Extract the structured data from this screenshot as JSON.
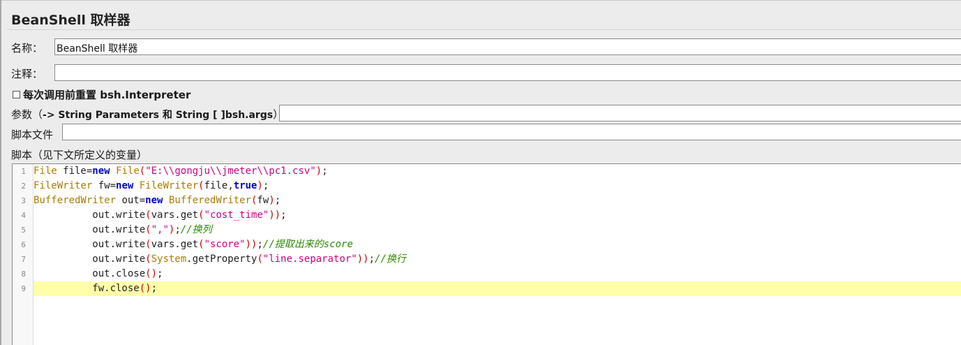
{
  "window": {
    "title": "BeanShell 取样器"
  },
  "form": {
    "name_label": "名称：",
    "name_value": "BeanShell 取样器",
    "comment_label": "注释：",
    "comment_value": "",
    "reset_checkbox_label": "每次调用前重置 bsh.Interpreter",
    "reset_checked": false,
    "params_label_prefix": "参数（",
    "params_label_bold": "-> String Parameters 和 String [ ]bsh.args",
    "params_label_suffix": "）",
    "params_value": "",
    "script_file_label": "脚本文件",
    "script_file_value": "",
    "script_label": "脚本（见下文所定义的变量）"
  },
  "editor": {
    "current_line": 9,
    "lines": [
      {
        "num": "1",
        "tokens": [
          {
            "t": "type",
            "v": "File"
          },
          {
            "t": "plain",
            "v": " file="
          },
          {
            "t": "kw",
            "v": "new"
          },
          {
            "t": "plain",
            "v": " "
          },
          {
            "t": "type",
            "v": "File"
          },
          {
            "t": "paren",
            "v": "("
          },
          {
            "t": "str",
            "v": "\"E:\\\\gongju\\\\jmeter\\\\pc1.csv\""
          },
          {
            "t": "paren",
            "v": ")"
          },
          {
            "t": "plain",
            "v": ";"
          }
        ]
      },
      {
        "num": "2",
        "tokens": [
          {
            "t": "type",
            "v": "FileWriter"
          },
          {
            "t": "plain",
            "v": " fw="
          },
          {
            "t": "kw",
            "v": "new"
          },
          {
            "t": "plain",
            "v": " "
          },
          {
            "t": "type",
            "v": "FileWriter"
          },
          {
            "t": "paren",
            "v": "("
          },
          {
            "t": "plain",
            "v": "file,"
          },
          {
            "t": "kw",
            "v": "true"
          },
          {
            "t": "paren",
            "v": ")"
          },
          {
            "t": "plain",
            "v": ";"
          }
        ]
      },
      {
        "num": "3",
        "tokens": [
          {
            "t": "type",
            "v": "BufferedWriter"
          },
          {
            "t": "plain",
            "v": " out="
          },
          {
            "t": "kw",
            "v": "new"
          },
          {
            "t": "plain",
            "v": " "
          },
          {
            "t": "type",
            "v": "BufferedWriter"
          },
          {
            "t": "paren",
            "v": "("
          },
          {
            "t": "plain",
            "v": "fw"
          },
          {
            "t": "paren",
            "v": ")"
          },
          {
            "t": "plain",
            "v": ";"
          }
        ]
      },
      {
        "num": "4",
        "tokens": [
          {
            "t": "plain",
            "v": "          out.write"
          },
          {
            "t": "paren",
            "v": "("
          },
          {
            "t": "plain",
            "v": "vars.get"
          },
          {
            "t": "paren",
            "v": "("
          },
          {
            "t": "str",
            "v": "\"cost_time\""
          },
          {
            "t": "paren",
            "v": "))"
          },
          {
            "t": "plain",
            "v": ";"
          }
        ]
      },
      {
        "num": "5",
        "tokens": [
          {
            "t": "plain",
            "v": "          out.write"
          },
          {
            "t": "paren",
            "v": "("
          },
          {
            "t": "str",
            "v": "\",\""
          },
          {
            "t": "paren",
            "v": ")"
          },
          {
            "t": "plain",
            "v": ";"
          },
          {
            "t": "cmt",
            "v": "//换列"
          }
        ]
      },
      {
        "num": "6",
        "tokens": [
          {
            "t": "plain",
            "v": "          out.write"
          },
          {
            "t": "paren",
            "v": "("
          },
          {
            "t": "plain",
            "v": "vars.get"
          },
          {
            "t": "paren",
            "v": "("
          },
          {
            "t": "str",
            "v": "\"score\""
          },
          {
            "t": "paren",
            "v": "))"
          },
          {
            "t": "plain",
            "v": ";"
          },
          {
            "t": "cmt",
            "v": "//提取出来的score"
          }
        ]
      },
      {
        "num": "7",
        "tokens": [
          {
            "t": "plain",
            "v": "          out.write"
          },
          {
            "t": "paren",
            "v": "("
          },
          {
            "t": "type",
            "v": "System"
          },
          {
            "t": "plain",
            "v": ".getProperty"
          },
          {
            "t": "paren",
            "v": "("
          },
          {
            "t": "str",
            "v": "\"line.separator\""
          },
          {
            "t": "paren",
            "v": "))"
          },
          {
            "t": "plain",
            "v": ";"
          },
          {
            "t": "cmt",
            "v": "//换行"
          }
        ]
      },
      {
        "num": "8",
        "tokens": [
          {
            "t": "plain",
            "v": "          out.close"
          },
          {
            "t": "paren",
            "v": "()"
          },
          {
            "t": "plain",
            "v": ";"
          }
        ]
      },
      {
        "num": "9",
        "tokens": [
          {
            "t": "plain",
            "v": "          fw.close"
          },
          {
            "t": "paren",
            "v": "()"
          },
          {
            "t": "plain",
            "v": ";"
          }
        ]
      }
    ]
  },
  "colors": {
    "background": "#ececec",
    "current_line_highlight": "#ffffaa",
    "keyword": "#0000d6",
    "type": "#b07a00",
    "string": "#cc0080",
    "paren": "#d40000",
    "comment": "#2a8a00"
  }
}
